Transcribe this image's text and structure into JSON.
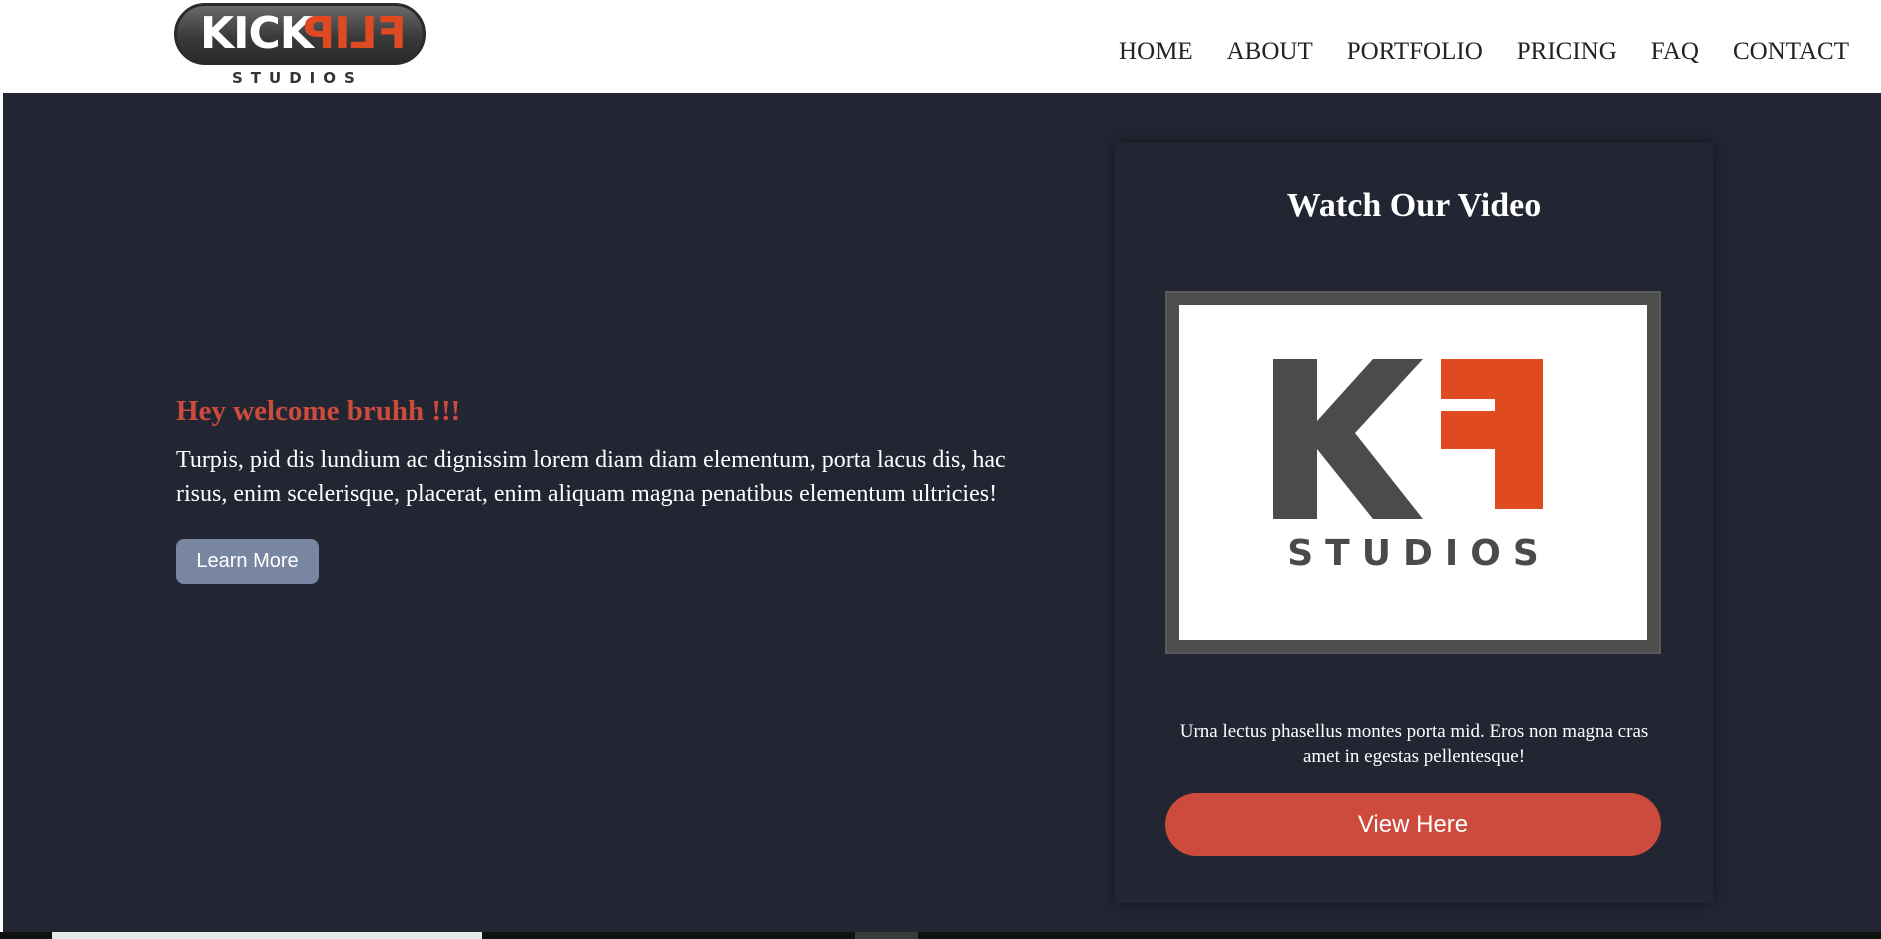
{
  "brand": {
    "logo_main_left": "KICK",
    "logo_main_right": "FLIP",
    "logo_sub": "STUDIOS",
    "accent_color": "#e04a22"
  },
  "nav": {
    "items": [
      {
        "label": "HOME"
      },
      {
        "label": "ABOUT"
      },
      {
        "label": "PORTFOLIO"
      },
      {
        "label": "PRICING"
      },
      {
        "label": "FAQ"
      },
      {
        "label": "CONTACT"
      }
    ]
  },
  "hero": {
    "heading": "Hey welcome bruhh !!!",
    "text": "Turpis, pid dis lundium ac dignissim lorem diam diam elementum, porta lacus dis, hac risus, enim scelerisque, placerat, enim aliquam magna penatibus elementum ultricies!",
    "button_label": "Learn More",
    "background_color": "#222633",
    "heading_color": "#cd4b3c",
    "button_color": "#7886a2"
  },
  "video_card": {
    "title": "Watch Our Video",
    "thumbnail_text": "STUDIOS",
    "caption": "Urna lectus phasellus montes porta mid. Eros non magna cras amet in egestas pellentesque!",
    "button_label": "View Here",
    "button_color": "#cd4b3c"
  }
}
